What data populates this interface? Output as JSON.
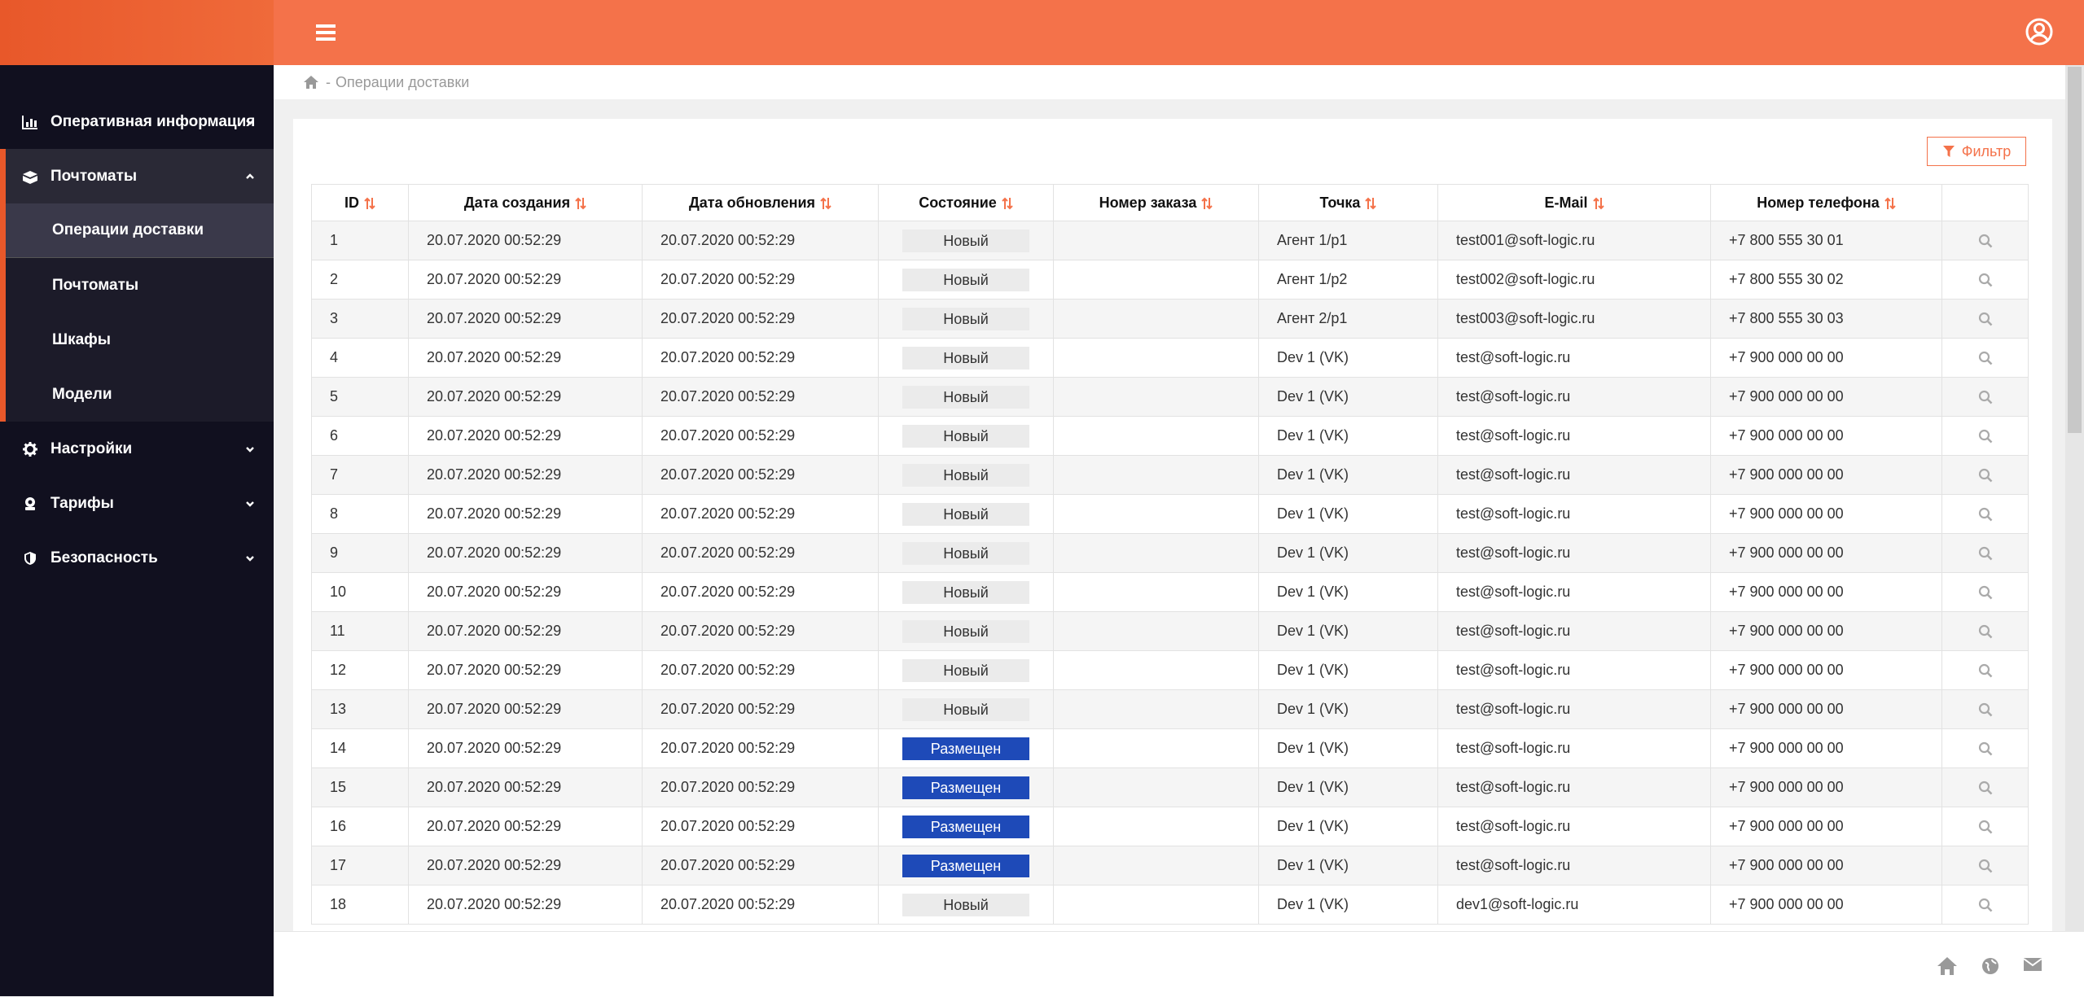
{
  "sidebar": {
    "items": [
      {
        "label": "Оперативная информация",
        "icon": "chart-bar-icon",
        "expanded": false
      },
      {
        "label": "Почтоматы",
        "icon": "boxes-icon",
        "expanded": true,
        "children": [
          "Операции доставки",
          "Почтоматы",
          "Шкафы",
          "Модели"
        ],
        "active_child": "Операции доставки"
      },
      {
        "label": "Настройки",
        "icon": "gear-icon",
        "expanded": false
      },
      {
        "label": "Тарифы",
        "icon": "tariff-icon",
        "expanded": false
      },
      {
        "label": "Безопасность",
        "icon": "shield-icon",
        "expanded": false
      }
    ]
  },
  "header": {
    "menu_icon": "hamburger-icon",
    "user_icon": "user-circle-icon"
  },
  "breadcrumb": {
    "home_icon": "home-icon",
    "separator": "-",
    "current": "Операции доставки"
  },
  "toolbar": {
    "filter_label": "Фильтр"
  },
  "table": {
    "columns": [
      "ID",
      "Дата создания",
      "Дата обновления",
      "Состояние",
      "Номер заказа",
      "Точка",
      "E-Mail",
      "Номер телефона",
      ""
    ],
    "rows": [
      {
        "id": "1",
        "created": "20.07.2020 00:52:29",
        "updated": "20.07.2020 00:52:29",
        "state": "Новый",
        "order": "",
        "point": "Агент 1/p1",
        "email": "test001@soft-logic.ru",
        "phone": "+7 800 555 30 01"
      },
      {
        "id": "2",
        "created": "20.07.2020 00:52:29",
        "updated": "20.07.2020 00:52:29",
        "state": "Новый",
        "order": "",
        "point": "Агент 1/p2",
        "email": "test002@soft-logic.ru",
        "phone": "+7 800 555 30 02"
      },
      {
        "id": "3",
        "created": "20.07.2020 00:52:29",
        "updated": "20.07.2020 00:52:29",
        "state": "Новый",
        "order": "",
        "point": "Агент 2/p1",
        "email": "test003@soft-logic.ru",
        "phone": "+7 800 555 30 03"
      },
      {
        "id": "4",
        "created": "20.07.2020 00:52:29",
        "updated": "20.07.2020 00:52:29",
        "state": "Новый",
        "order": "",
        "point": "Dev 1 (VK)",
        "email": "test@soft-logic.ru",
        "phone": "+7 900 000 00 00"
      },
      {
        "id": "5",
        "created": "20.07.2020 00:52:29",
        "updated": "20.07.2020 00:52:29",
        "state": "Новый",
        "order": "",
        "point": "Dev 1 (VK)",
        "email": "test@soft-logic.ru",
        "phone": "+7 900 000 00 00"
      },
      {
        "id": "6",
        "created": "20.07.2020 00:52:29",
        "updated": "20.07.2020 00:52:29",
        "state": "Новый",
        "order": "",
        "point": "Dev 1 (VK)",
        "email": "test@soft-logic.ru",
        "phone": "+7 900 000 00 00"
      },
      {
        "id": "7",
        "created": "20.07.2020 00:52:29",
        "updated": "20.07.2020 00:52:29",
        "state": "Новый",
        "order": "",
        "point": "Dev 1 (VK)",
        "email": "test@soft-logic.ru",
        "phone": "+7 900 000 00 00"
      },
      {
        "id": "8",
        "created": "20.07.2020 00:52:29",
        "updated": "20.07.2020 00:52:29",
        "state": "Новый",
        "order": "",
        "point": "Dev 1 (VK)",
        "email": "test@soft-logic.ru",
        "phone": "+7 900 000 00 00"
      },
      {
        "id": "9",
        "created": "20.07.2020 00:52:29",
        "updated": "20.07.2020 00:52:29",
        "state": "Новый",
        "order": "",
        "point": "Dev 1 (VK)",
        "email": "test@soft-logic.ru",
        "phone": "+7 900 000 00 00"
      },
      {
        "id": "10",
        "created": "20.07.2020 00:52:29",
        "updated": "20.07.2020 00:52:29",
        "state": "Новый",
        "order": "",
        "point": "Dev 1 (VK)",
        "email": "test@soft-logic.ru",
        "phone": "+7 900 000 00 00"
      },
      {
        "id": "11",
        "created": "20.07.2020 00:52:29",
        "updated": "20.07.2020 00:52:29",
        "state": "Новый",
        "order": "",
        "point": "Dev 1 (VK)",
        "email": "test@soft-logic.ru",
        "phone": "+7 900 000 00 00"
      },
      {
        "id": "12",
        "created": "20.07.2020 00:52:29",
        "updated": "20.07.2020 00:52:29",
        "state": "Новый",
        "order": "",
        "point": "Dev 1 (VK)",
        "email": "test@soft-logic.ru",
        "phone": "+7 900 000 00 00"
      },
      {
        "id": "13",
        "created": "20.07.2020 00:52:29",
        "updated": "20.07.2020 00:52:29",
        "state": "Новый",
        "order": "",
        "point": "Dev 1 (VK)",
        "email": "test@soft-logic.ru",
        "phone": "+7 900 000 00 00"
      },
      {
        "id": "14",
        "created": "20.07.2020 00:52:29",
        "updated": "20.07.2020 00:52:29",
        "state": "Размещен",
        "order": "",
        "point": "Dev 1 (VK)",
        "email": "test@soft-logic.ru",
        "phone": "+7 900 000 00 00"
      },
      {
        "id": "15",
        "created": "20.07.2020 00:52:29",
        "updated": "20.07.2020 00:52:29",
        "state": "Размещен",
        "order": "",
        "point": "Dev 1 (VK)",
        "email": "test@soft-logic.ru",
        "phone": "+7 900 000 00 00"
      },
      {
        "id": "16",
        "created": "20.07.2020 00:52:29",
        "updated": "20.07.2020 00:52:29",
        "state": "Размещен",
        "order": "",
        "point": "Dev 1 (VK)",
        "email": "test@soft-logic.ru",
        "phone": "+7 900 000 00 00"
      },
      {
        "id": "17",
        "created": "20.07.2020 00:52:29",
        "updated": "20.07.2020 00:52:29",
        "state": "Размещен",
        "order": "",
        "point": "Dev 1 (VK)",
        "email": "test@soft-logic.ru",
        "phone": "+7 900 000 00 00"
      },
      {
        "id": "18",
        "created": "20.07.2020 00:52:29",
        "updated": "20.07.2020 00:52:29",
        "state": "Новый",
        "order": "",
        "point": "Dev 1 (VK)",
        "email": "dev1@soft-logic.ru",
        "phone": "+7 900 000 00 00"
      }
    ]
  },
  "states": {
    "placed": "Размещен"
  },
  "footer": {
    "icons": [
      "home-icon",
      "globe-icon",
      "envelope-icon"
    ]
  },
  "colors": {
    "accent": "#f4724a",
    "sidebar_bg": "#11101f",
    "placed_badge": "#1e4ab8"
  }
}
